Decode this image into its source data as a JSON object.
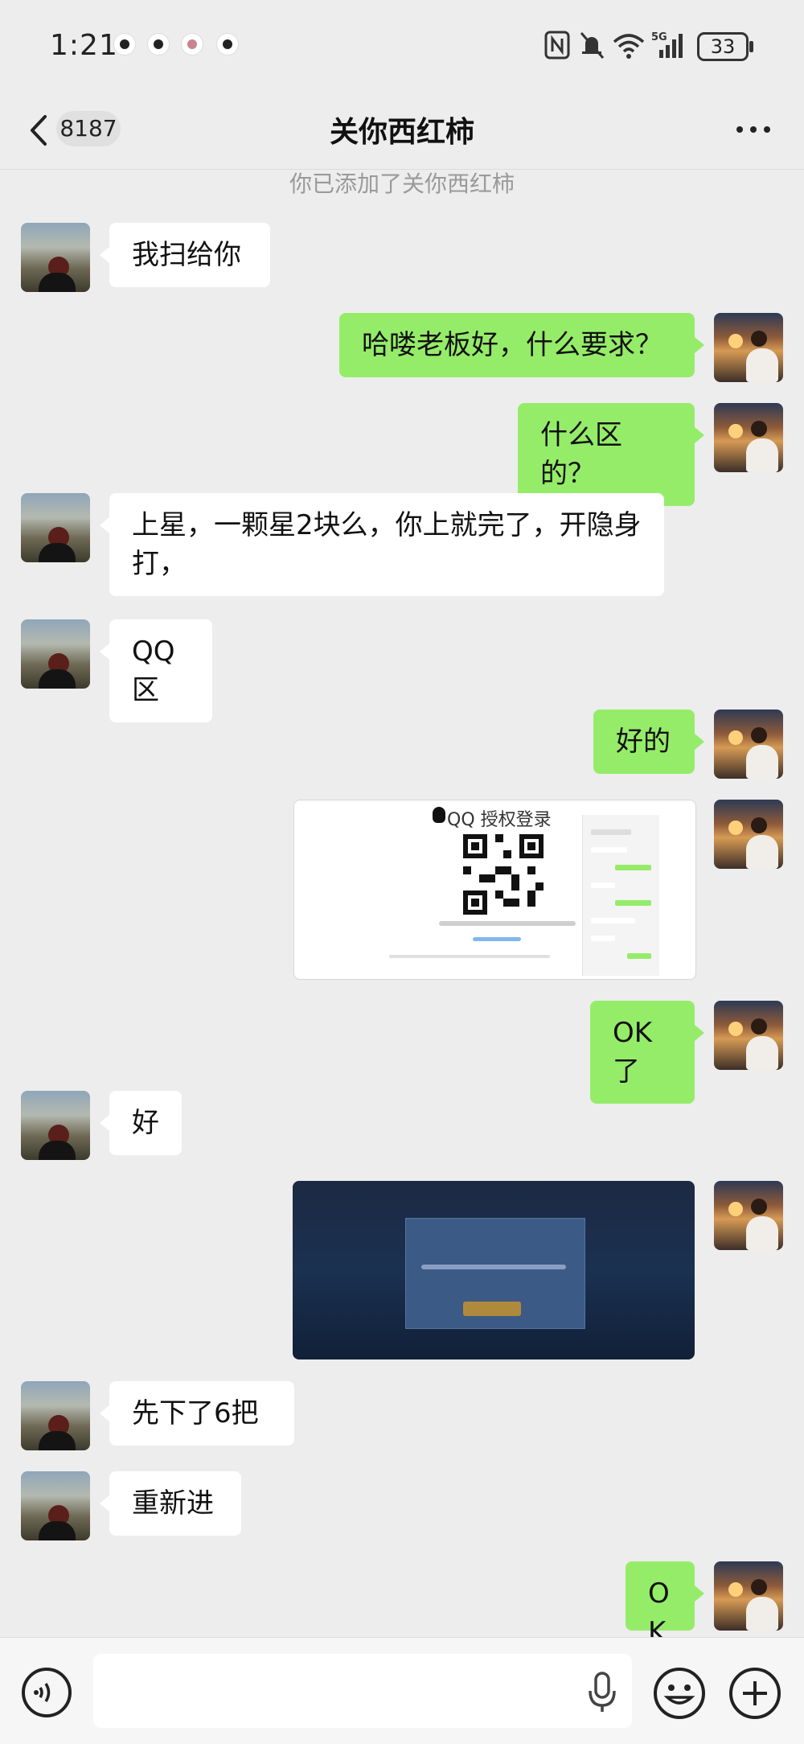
{
  "status_bar": {
    "time": "1:21",
    "battery": "33",
    "network": "5G"
  },
  "nav": {
    "unread_count": "8187",
    "title": "关你西红柿"
  },
  "system_note": "你已添加了关你西红柿",
  "messages": [
    {
      "side": "in",
      "text": "我扫给你"
    },
    {
      "side": "out",
      "text": "哈喽老板好，什么要求？"
    },
    {
      "side": "out",
      "text": "什么区的？"
    },
    {
      "side": "in",
      "text": "上星，一颗星2块么，你上就完了，开隐身打，"
    },
    {
      "side": "in",
      "text": "QQ区"
    },
    {
      "side": "out",
      "text": "好的"
    },
    {
      "side": "out",
      "type": "image",
      "image_title": "QQ 授权登录"
    },
    {
      "side": "out",
      "text": "OK了"
    },
    {
      "side": "in",
      "text": "好"
    },
    {
      "side": "out",
      "type": "image"
    },
    {
      "side": "in",
      "text": "先下了6把"
    },
    {
      "side": "in",
      "text": "重新进"
    },
    {
      "side": "out",
      "text": "OK"
    }
  ],
  "colors": {
    "background": "#ededed",
    "outgoing_bubble": "#95ec69",
    "incoming_bubble": "#ffffff"
  },
  "icons": {
    "back": "chevron-left-icon",
    "more": "more-dots-icon",
    "voice": "voice-toggle-icon",
    "mic": "microphone-icon",
    "emoji": "emoji-icon",
    "plus": "plus-icon"
  }
}
